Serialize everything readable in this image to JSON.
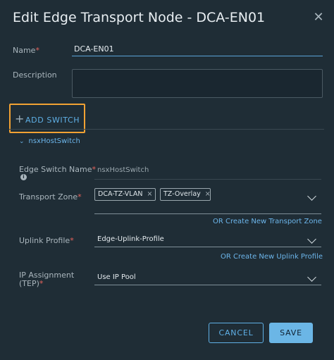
{
  "dialog": {
    "title": "Edit Edge Transport Node - DCA-EN01",
    "close_icon": "close-icon"
  },
  "form": {
    "name": {
      "label": "Name",
      "required_mark": "*",
      "value": "DCA-EN01"
    },
    "description": {
      "label": "Description",
      "value": ""
    },
    "add_switch_label": "ADD SWITCH",
    "add_switch_icon": "plus-icon",
    "switch_section": {
      "title": "nsxHostSwitch",
      "edge_switch_name": {
        "label": "Edge Switch Name",
        "required_mark": "*",
        "value": "nsxHostSwitch"
      },
      "transport_zone": {
        "label": "Transport Zone",
        "required_mark": "*",
        "chips": [
          "DCA-TZ-VLAN",
          "TZ-Overlay"
        ],
        "chip_remove": "×",
        "create_link": "OR Create New Transport Zone"
      },
      "uplink_profile": {
        "label": "Uplink Profile",
        "required_mark": "*",
        "value": "Edge-Uplink-Profile",
        "create_link": "OR Create New Uplink Profile"
      },
      "ip_assignment": {
        "label_line1": "IP Assignment",
        "label_line2": "(TEP)",
        "required_mark": "*",
        "value": "Use IP Pool"
      }
    }
  },
  "buttons": {
    "cancel": "CANCEL",
    "save": "SAVE"
  },
  "colors": {
    "background": "#1f2d36",
    "accent": "#5fb0e6",
    "required": "#e7635c",
    "highlight": "#f2a233",
    "save_fill": "#6bb6e6"
  }
}
